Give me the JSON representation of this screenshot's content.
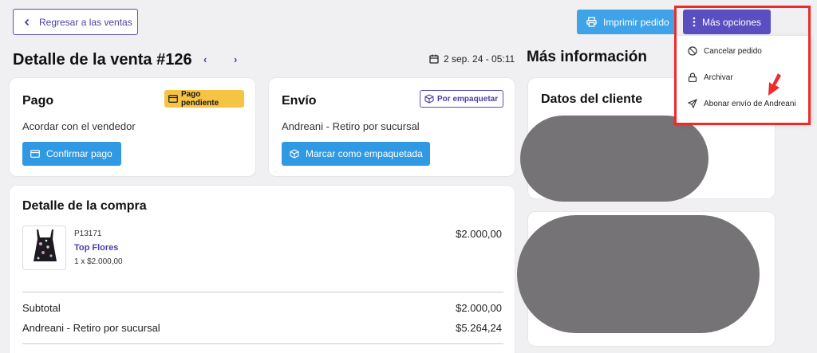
{
  "header": {
    "back_label": "Regresar a las ventas",
    "print_label": "Imprimir pedido",
    "more_label": "Más opciones"
  },
  "page": {
    "title": "Detalle de la venta #126",
    "date": "2 sep. 24 - 05:11",
    "more_info_title": "Más información"
  },
  "pago": {
    "title": "Pago",
    "badge": "Pago pendiente",
    "text": "Acordar con el vendedor",
    "button": "Confirmar pago"
  },
  "envio": {
    "title": "Envío",
    "badge": "Por empaquetar",
    "text": "Andreani - Retiro por sucursal",
    "button": "Marcar como empaquetada"
  },
  "compra": {
    "title": "Detalle de la compra",
    "item": {
      "sku": "P13171",
      "name": "Top Flores",
      "qty_price": "1 x $2.000,00",
      "total": "$2.000,00"
    },
    "subtotal_label": "Subtotal",
    "subtotal_value": "$2.000,00",
    "shipping_label": "Andreani - Retiro por sucursal",
    "shipping_value": "$5.264,24"
  },
  "cliente": {
    "title": "Datos del cliente"
  },
  "menu": {
    "items": [
      "Cancelar pedido",
      "Archivar",
      "Abonar envío de Andreani"
    ]
  },
  "colors": {
    "accent": "#5a4fc0",
    "button_blue": "#2f9ae3",
    "badge_yellow": "#f6c445",
    "highlight_red": "#ee2b2b"
  }
}
